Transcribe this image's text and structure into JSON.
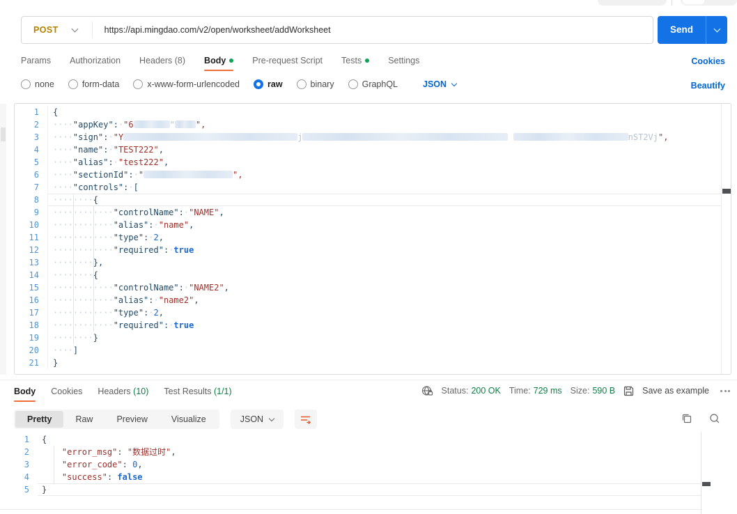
{
  "request": {
    "method": "POST",
    "url": "https://api.mingdao.com/v2/open/worksheet/addWorksheet",
    "send_label": "Send",
    "cookies_link": "Cookies",
    "beautify_link": "Beautify",
    "tabs": [
      {
        "label": "Params"
      },
      {
        "label": "Authorization"
      },
      {
        "label": "Headers (8)"
      },
      {
        "label": "Body",
        "active": true,
        "dot": true
      },
      {
        "label": "Pre-request Script"
      },
      {
        "label": "Tests",
        "dot": true
      },
      {
        "label": "Settings"
      }
    ],
    "body_types": [
      {
        "label": "none"
      },
      {
        "label": "form-data"
      },
      {
        "label": "x-www-form-urlencoded"
      },
      {
        "label": "raw",
        "selected": true
      },
      {
        "label": "binary"
      },
      {
        "label": "GraphQL"
      }
    ],
    "language": "JSON"
  },
  "request_editor": {
    "lines": [
      {
        "n": 1,
        "seg": [
          [
            "p",
            "{"
          ]
        ]
      },
      {
        "n": 2,
        "seg": [
          [
            "ws",
            4
          ],
          [
            "key",
            "\"appKey\""
          ],
          [
            "p",
            ":"
          ],
          [
            "ws",
            1
          ],
          [
            "str",
            "\"6"
          ],
          [
            "blur",
            52
          ],
          [
            "faint",
            "\""
          ],
          [
            "blur",
            30
          ],
          [
            "str",
            "\","
          ]
        ]
      },
      {
        "n": 3,
        "seg": [
          [
            "ws",
            4
          ],
          [
            "key",
            "\"sign\""
          ],
          [
            "p",
            ":"
          ],
          [
            "ws",
            1
          ],
          [
            "str",
            "\"Y"
          ],
          [
            "blur",
            250
          ],
          [
            "faint",
            "j"
          ],
          [
            "blur",
            295
          ],
          [
            "faint",
            " "
          ],
          [
            "blur",
            165
          ],
          [
            "faint",
            "nST2Vj"
          ],
          [
            "str",
            "\","
          ]
        ]
      },
      {
        "n": 4,
        "seg": [
          [
            "ws",
            4
          ],
          [
            "key",
            "\"name\""
          ],
          [
            "p",
            ":"
          ],
          [
            "ws",
            1
          ],
          [
            "str",
            "\"TEST222\""
          ],
          [
            "p",
            ","
          ]
        ]
      },
      {
        "n": 5,
        "seg": [
          [
            "ws",
            4
          ],
          [
            "key",
            "\"alias\""
          ],
          [
            "p",
            ":"
          ],
          [
            "ws",
            1
          ],
          [
            "str",
            "\"test222\""
          ],
          [
            "p",
            ","
          ]
        ]
      },
      {
        "n": 6,
        "seg": [
          [
            "ws",
            4
          ],
          [
            "key",
            "\"sectionId\""
          ],
          [
            "p",
            ":"
          ],
          [
            "ws",
            1
          ],
          [
            "str",
            "\""
          ],
          [
            "blur",
            128
          ],
          [
            "str",
            "\","
          ]
        ]
      },
      {
        "n": 7,
        "seg": [
          [
            "ws",
            4
          ],
          [
            "key",
            "\"controls\""
          ],
          [
            "p",
            ":"
          ],
          [
            "ws",
            1
          ],
          [
            "p",
            "["
          ]
        ]
      },
      {
        "n": 8,
        "active": true,
        "seg": [
          [
            "ws",
            8
          ],
          [
            "p",
            "{"
          ]
        ]
      },
      {
        "n": 9,
        "seg": [
          [
            "ws",
            12
          ],
          [
            "key",
            "\"controlName\""
          ],
          [
            "p",
            ":"
          ],
          [
            "ws",
            1
          ],
          [
            "str",
            "\"NAME\""
          ],
          [
            "p",
            ","
          ]
        ]
      },
      {
        "n": 10,
        "seg": [
          [
            "ws",
            12
          ],
          [
            "key",
            "\"alias\""
          ],
          [
            "p",
            ":"
          ],
          [
            "ws",
            1
          ],
          [
            "str",
            "\"name\""
          ],
          [
            "p",
            ","
          ]
        ]
      },
      {
        "n": 11,
        "seg": [
          [
            "ws",
            12
          ],
          [
            "key",
            "\"type\""
          ],
          [
            "p",
            ":"
          ],
          [
            "ws",
            1
          ],
          [
            "num",
            "2"
          ],
          [
            "p",
            ","
          ]
        ]
      },
      {
        "n": 12,
        "seg": [
          [
            "ws",
            12
          ],
          [
            "key",
            "\"required\""
          ],
          [
            "p",
            ":"
          ],
          [
            "ws",
            1
          ],
          [
            "bool",
            "true"
          ]
        ]
      },
      {
        "n": 13,
        "seg": [
          [
            "ws",
            8
          ],
          [
            "p",
            "},"
          ]
        ]
      },
      {
        "n": 14,
        "seg": [
          [
            "ws",
            8
          ],
          [
            "p",
            "{"
          ]
        ]
      },
      {
        "n": 15,
        "seg": [
          [
            "ws",
            12
          ],
          [
            "key",
            "\"controlName\""
          ],
          [
            "p",
            ":"
          ],
          [
            "ws",
            1
          ],
          [
            "str",
            "\"NAME2\""
          ],
          [
            "p",
            ","
          ]
        ]
      },
      {
        "n": 16,
        "seg": [
          [
            "ws",
            12
          ],
          [
            "key",
            "\"alias\""
          ],
          [
            "p",
            ":"
          ],
          [
            "ws",
            1
          ],
          [
            "str",
            "\"name2\""
          ],
          [
            "p",
            ","
          ]
        ]
      },
      {
        "n": 17,
        "seg": [
          [
            "ws",
            12
          ],
          [
            "key",
            "\"type\""
          ],
          [
            "p",
            ":"
          ],
          [
            "ws",
            1
          ],
          [
            "num",
            "2"
          ],
          [
            "p",
            ","
          ]
        ]
      },
      {
        "n": 18,
        "seg": [
          [
            "ws",
            12
          ],
          [
            "key",
            "\"required\""
          ],
          [
            "p",
            ":"
          ],
          [
            "ws",
            1
          ],
          [
            "bool",
            "true"
          ]
        ]
      },
      {
        "n": 19,
        "seg": [
          [
            "ws",
            8
          ],
          [
            "p",
            "}"
          ]
        ]
      },
      {
        "n": 20,
        "seg": [
          [
            "ws",
            4
          ],
          [
            "p",
            "]"
          ]
        ]
      },
      {
        "n": 21,
        "seg": [
          [
            "p",
            "}"
          ]
        ]
      }
    ]
  },
  "response": {
    "tabs": [
      {
        "label": "Body",
        "active": true
      },
      {
        "label": "Cookies"
      },
      {
        "label": "Headers",
        "count": "(10)"
      },
      {
        "label": "Test Results",
        "count": "(1/1)"
      }
    ],
    "status_label": "Status:",
    "status_value": "200 OK",
    "time_label": "Time:",
    "time_value": "729 ms",
    "size_label": "Size:",
    "size_value": "590 B",
    "save_label": "Save as example",
    "view_tabs": [
      {
        "label": "Pretty",
        "active": true
      },
      {
        "label": "Raw"
      },
      {
        "label": "Preview"
      },
      {
        "label": "Visualize"
      }
    ],
    "language": "JSON"
  },
  "response_editor": {
    "lines": [
      {
        "n": 1,
        "seg": [
          [
            "p",
            "{"
          ]
        ]
      },
      {
        "n": 2,
        "seg": [
          [
            "sp",
            4
          ],
          [
            "key",
            "\"error_msg\""
          ],
          [
            "p",
            ":"
          ],
          [
            "sp",
            1
          ],
          [
            "str",
            "\"数据过时\""
          ],
          [
            "p",
            ","
          ]
        ]
      },
      {
        "n": 3,
        "seg": [
          [
            "sp",
            4
          ],
          [
            "key",
            "\"error_code\""
          ],
          [
            "p",
            ":"
          ],
          [
            "sp",
            1
          ],
          [
            "num",
            "0"
          ],
          [
            "p",
            ","
          ]
        ]
      },
      {
        "n": 4,
        "seg": [
          [
            "sp",
            4
          ],
          [
            "key",
            "\"success\""
          ],
          [
            "p",
            ":"
          ],
          [
            "sp",
            1
          ],
          [
            "bool",
            "false"
          ]
        ]
      },
      {
        "n": 5,
        "active": true,
        "seg": [
          [
            "p",
            "}"
          ]
        ]
      }
    ]
  },
  "icons": [
    "chevron-down-icon",
    "globe-lock-icon",
    "save-icon",
    "more-options-icon",
    "copy-icon",
    "search-icon",
    "wrap-text-icon"
  ],
  "colors": {
    "accent_blue": "#1373e6",
    "link_blue": "#0265d2",
    "tab_underline_orange": "#ee6b3a",
    "status_green": "#0e7e45",
    "dot_green": "#10a355",
    "method_post_amber": "#b28100",
    "code_key_navy": "#214a68",
    "code_string_maroon": "#9e2f2a",
    "code_number_blue": "#1a67cd"
  }
}
